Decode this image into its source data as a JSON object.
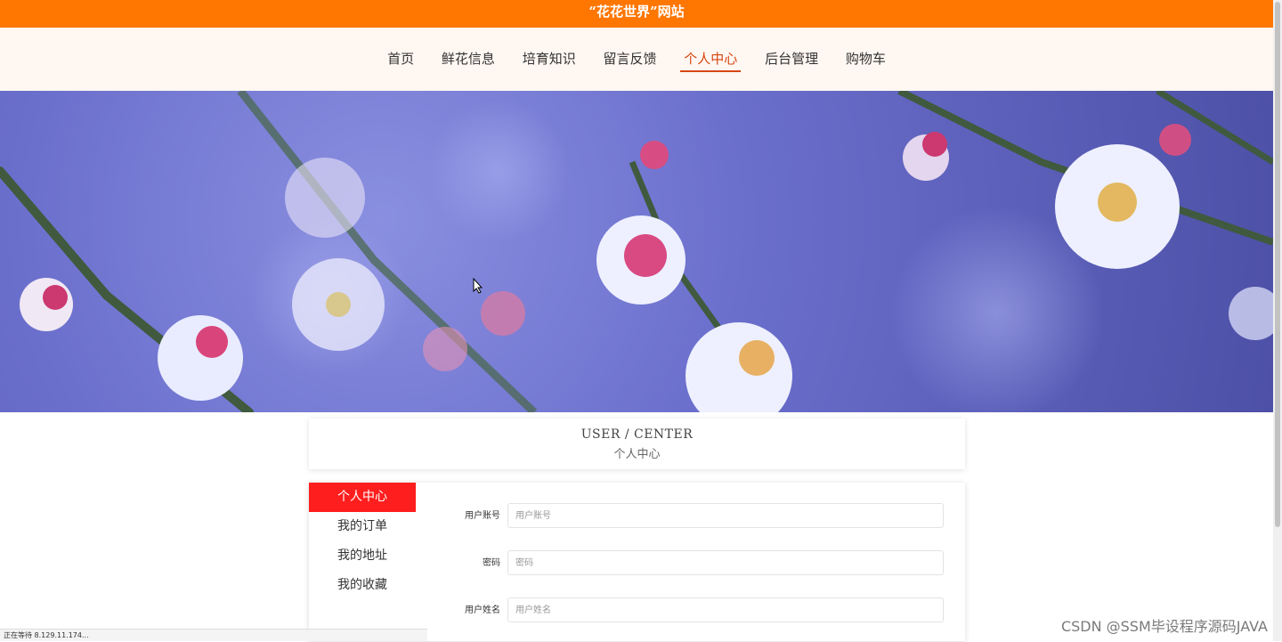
{
  "site": {
    "title": "“花花世界”网站"
  },
  "nav": {
    "items": [
      {
        "label": "首页"
      },
      {
        "label": "鲜花信息"
      },
      {
        "label": "培育知识"
      },
      {
        "label": "留言反馈"
      },
      {
        "label": "个人中心",
        "active": true
      },
      {
        "label": "后台管理"
      },
      {
        "label": "购物车"
      }
    ]
  },
  "banner": {
    "description_icon": "plum-blossom-photo"
  },
  "section": {
    "title_en": "USER / CENTER",
    "title_cn": "个人中心"
  },
  "sidebar": {
    "items": [
      {
        "label": "个人中心",
        "active": true
      },
      {
        "label": "我的订单"
      },
      {
        "label": "我的地址"
      },
      {
        "label": "我的收藏"
      }
    ]
  },
  "form": {
    "fields": [
      {
        "label": "用户账号",
        "placeholder": "用户账号",
        "value": ""
      },
      {
        "label": "密码",
        "placeholder": "密码",
        "value": ""
      },
      {
        "label": "用户姓名",
        "placeholder": "用户姓名",
        "value": ""
      }
    ]
  },
  "status_bar": {
    "text": "正在等待 8.129.11.174..."
  },
  "watermark": {
    "text": "CSDN @SSM毕设程序源码JAVA"
  },
  "colors": {
    "brand": "#ff7600",
    "nav_active": "#d6450e",
    "sidebar_active": "#ff1e1e"
  }
}
